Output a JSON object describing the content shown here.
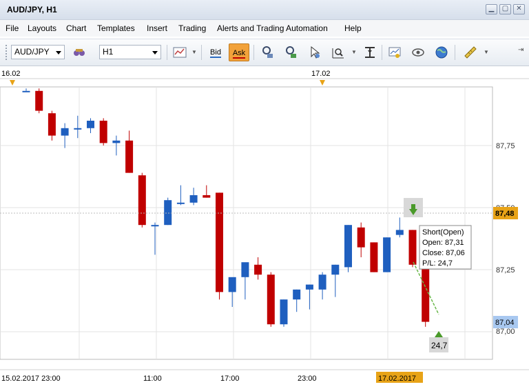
{
  "window": {
    "title": "AUD/JPY, H1"
  },
  "menu": [
    "File",
    "Layouts",
    "Chart",
    "Templates",
    "Insert",
    "Trading",
    "Alerts and Trading Automation",
    "Help"
  ],
  "toolbar": {
    "symbol": "AUD/JPY",
    "timeframe": "H1",
    "bid_label": "Bid",
    "ask_label": "Ask",
    "icons": [
      "chart-type-icon",
      "binoculars-icon",
      "indicator-icon",
      "cursor-icon",
      "zoom-icon",
      "period-separator-icon",
      "chart-settings-icon",
      "view-icon",
      "globe-icon",
      "ruler-icon"
    ]
  },
  "chart": {
    "dates_top": [
      "16.02",
      "17.02"
    ],
    "time_labels": [
      "15.02.2017 23:00",
      "11:00",
      "17:00",
      "23:00",
      "17.02.2017"
    ],
    "price_labels": [
      "87,75",
      "87,50",
      "87,25",
      "87,00"
    ],
    "current_price": "87,48",
    "position_price": "87,04",
    "tooltip": {
      "line1": "Short(Open)",
      "line2": "Open: 87,31",
      "line3": "Close: 87,06",
      "line4": "P/L: 24,7"
    },
    "pl_label": "24,7",
    "colors": {
      "bull": "#1f5fbf",
      "bear": "#c00000",
      "price_tag": "#e8a317",
      "position_tag": "#a8c8f0"
    }
  },
  "chart_data": {
    "type": "candlestick",
    "title": "AUD/JPY, H1",
    "ylim": [
      86.86,
      87.99
    ],
    "candles": [
      {
        "o": 87.97,
        "h": 87.98,
        "l": 87.97,
        "c": 87.97
      },
      {
        "o": 87.97,
        "h": 87.98,
        "l": 87.88,
        "c": 87.89
      },
      {
        "o": 87.88,
        "h": 87.89,
        "l": 87.77,
        "c": 87.79
      },
      {
        "o": 87.79,
        "h": 87.84,
        "l": 87.74,
        "c": 87.82
      },
      {
        "o": 87.82,
        "h": 87.87,
        "l": 87.78,
        "c": 87.82
      },
      {
        "o": 87.82,
        "h": 87.86,
        "l": 87.8,
        "c": 87.85
      },
      {
        "o": 87.85,
        "h": 87.86,
        "l": 87.75,
        "c": 87.76
      },
      {
        "o": 87.76,
        "h": 87.79,
        "l": 87.71,
        "c": 87.77
      },
      {
        "o": 87.77,
        "h": 87.81,
        "l": 87.64,
        "c": 87.64
      },
      {
        "o": 87.63,
        "h": 87.64,
        "l": 87.42,
        "c": 87.43
      },
      {
        "o": 87.43,
        "h": 87.44,
        "l": 87.31,
        "c": 87.43
      },
      {
        "o": 87.43,
        "h": 87.54,
        "l": 87.43,
        "c": 87.53
      },
      {
        "o": 87.52,
        "h": 87.59,
        "l": 87.51,
        "c": 87.52
      },
      {
        "o": 87.52,
        "h": 87.58,
        "l": 87.51,
        "c": 87.55
      },
      {
        "o": 87.55,
        "h": 87.59,
        "l": 87.54,
        "c": 87.54
      },
      {
        "o": 87.56,
        "h": 87.56,
        "l": 87.13,
        "c": 87.16
      },
      {
        "o": 87.16,
        "h": 87.21,
        "l": 87.1,
        "c": 87.22
      },
      {
        "o": 87.22,
        "h": 87.27,
        "l": 87.13,
        "c": 87.28
      },
      {
        "o": 87.27,
        "h": 87.3,
        "l": 87.21,
        "c": 87.23
      },
      {
        "o": 87.23,
        "h": 87.24,
        "l": 87.02,
        "c": 87.03
      },
      {
        "o": 87.03,
        "h": 87.13,
        "l": 87.02,
        "c": 87.13
      },
      {
        "o": 87.13,
        "h": 87.17,
        "l": 87.08,
        "c": 87.17
      },
      {
        "o": 87.17,
        "h": 87.19,
        "l": 87.09,
        "c": 87.19
      },
      {
        "o": 87.17,
        "h": 87.24,
        "l": 87.13,
        "c": 87.23
      },
      {
        "o": 87.23,
        "h": 87.27,
        "l": 87.14,
        "c": 87.27
      },
      {
        "o": 87.26,
        "h": 87.43,
        "l": 87.24,
        "c": 87.43
      },
      {
        "o": 87.42,
        "h": 87.44,
        "l": 87.3,
        "c": 87.34
      },
      {
        "o": 87.36,
        "h": 87.36,
        "l": 87.24,
        "c": 87.24
      },
      {
        "o": 87.24,
        "h": 87.38,
        "l": 87.24,
        "c": 87.38
      },
      {
        "o": 87.39,
        "h": 87.46,
        "l": 87.38,
        "c": 87.41
      },
      {
        "o": 87.41,
        "h": 87.41,
        "l": 87.26,
        "c": 87.27
      },
      {
        "o": 87.26,
        "h": 87.26,
        "l": 87.02,
        "c": 87.04
      }
    ]
  }
}
